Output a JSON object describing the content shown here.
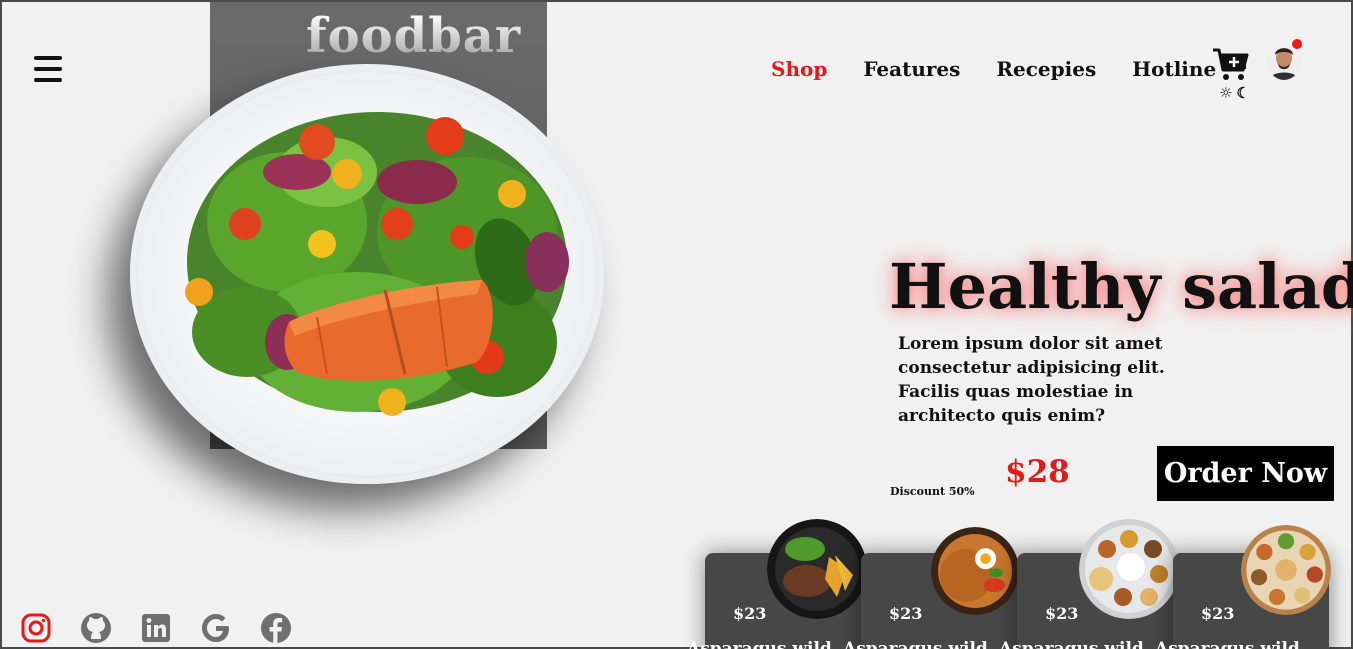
{
  "brand": {
    "logo": "foodbar"
  },
  "header": {
    "menu_icon": "hamburger-icon",
    "nav": [
      {
        "label": "Shop",
        "active": true
      },
      {
        "label": "Features",
        "active": false
      },
      {
        "label": "Recepies",
        "active": false
      },
      {
        "label": "Hotline",
        "active": false
      }
    ],
    "cart_icon": "cart-plus-icon",
    "theme_icons": [
      "sun-icon",
      "moon-icon"
    ],
    "theme_glyphs": {
      "sun": "☼",
      "moon": "☾"
    },
    "avatar": "user-avatar",
    "notification_color": "#ff1414"
  },
  "hero": {
    "title": "Healthy salad",
    "description": "Lorem ipsum dolor sit amet consectetur adipisicing elit. Facilis quas molestiae in architecto quis enim?",
    "discount": "Discount 50%",
    "price": "$28",
    "order_button": "Order Now"
  },
  "cards": [
    {
      "price": "$23",
      "name": "Asparagus wild"
    },
    {
      "price": "$23",
      "name": "Asparagus wild"
    },
    {
      "price": "$23",
      "name": "Asparagus wild"
    },
    {
      "price": "$23",
      "name": "Asparagus wild"
    }
  ],
  "socials": [
    "instagram-icon",
    "github-icon",
    "linkedin-icon",
    "google-icon",
    "facebook-icon"
  ],
  "colors": {
    "accent": "#e01b1b",
    "background": "#f1f1f1",
    "card": "#474747",
    "panel": "#636363"
  }
}
